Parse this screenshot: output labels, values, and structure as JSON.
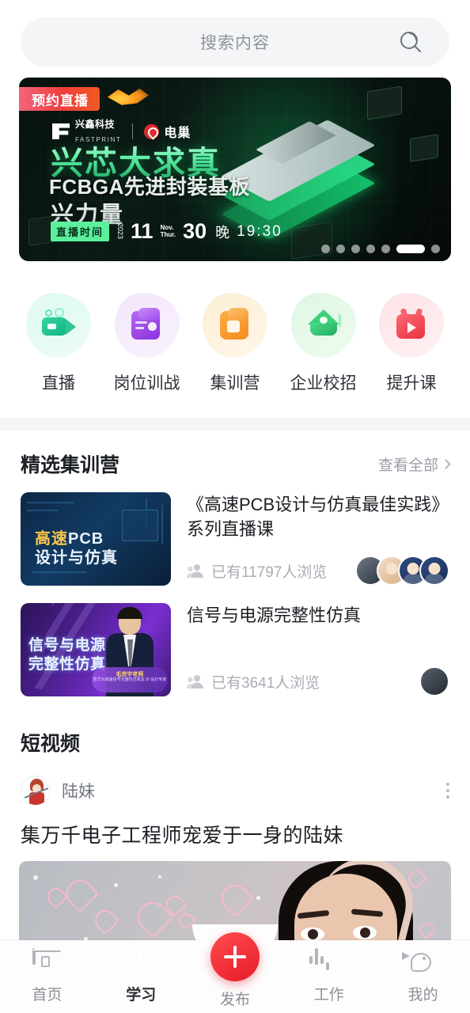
{
  "search": {
    "placeholder": "搜索内容",
    "icon": "search-icon"
  },
  "banner": {
    "badge": "预约直播",
    "logo_left_cn": "兴鑫科技",
    "logo_left_en": "FASTPRINT",
    "logo_right": "电巢",
    "headline1": "兴芯大求真",
    "headline2": "FCBGA先进封装基板",
    "headline3": "兴力量",
    "time_tag": "直播时间",
    "year": "2023",
    "month": "11",
    "month_en": "Nov.",
    "day": "30",
    "day_en": "Thur.",
    "evening": "晚",
    "clock": "19:30",
    "dots_total": 7,
    "dots_active_index": 5
  },
  "categories": [
    {
      "label": "直播",
      "icon": "live-camera-icon",
      "color": "#2ec697"
    },
    {
      "label": "岗位训战",
      "icon": "job-card-icon",
      "color": "#8b2fe0"
    },
    {
      "label": "集训营",
      "icon": "training-folder-icon",
      "color": "#f58b1e"
    },
    {
      "label": "企业校招",
      "icon": "graduation-cap-icon",
      "color": "#23ab5f"
    },
    {
      "label": "提升课",
      "icon": "video-play-icon",
      "color": "#e8323f"
    }
  ],
  "featured": {
    "title": "精选集训营",
    "more_label": "查看全部",
    "more_icon": "chevron-right-icon",
    "courses": [
      {
        "title": "《高速PCB设计与仿真最佳实践》系列直播课",
        "views": "已有11797人浏览",
        "views_icon": "people-group-icon",
        "thumb_line1_a": "高速",
        "thumb_line1_b": "PCB",
        "thumb_line2": "设计与仿真",
        "avatar_count": 4
      },
      {
        "title": "信号与电源完整性仿真",
        "views": "已有3641人浏览",
        "views_icon": "people-group-icon",
        "thumb_line1": "信号与电源",
        "thumb_line2": "完整性仿真",
        "thumb_tag_name": "毛宗宇老师",
        "thumb_tag_desc": "原华为高速信号光整性仿真及 SI 设计专家",
        "avatar_count": 1
      }
    ]
  },
  "short_video": {
    "title": "短视频",
    "user": "陆妹",
    "avatar": "anime-girl-avatar",
    "more_icon": "more-vertical-icon",
    "post_title": "集万千电子工程师宠爱于一身的陆妹"
  },
  "bottom_nav": {
    "active_index": 1,
    "items": [
      {
        "label": "首页",
        "icon": "home-chip-icon"
      },
      {
        "label": "学习",
        "icon": "book-plus-icon"
      },
      {
        "label": "发布",
        "icon": "plus-circle-icon"
      },
      {
        "label": "工作",
        "icon": "power-socket-icon"
      },
      {
        "label": "我的",
        "icon": "bird-icon"
      }
    ]
  },
  "colors": {
    "accent_red": "#e61c2a",
    "bg": "#ffffff",
    "band": "#f4f5f7",
    "muted": "#a9adb4"
  }
}
